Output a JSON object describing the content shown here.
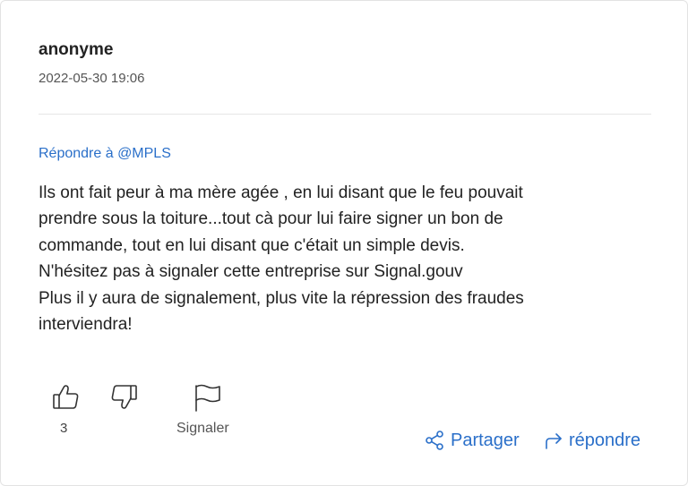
{
  "comment": {
    "author": "anonyme",
    "date": "2022-05-30 19:06",
    "reply_to": "Répondre à @MPLS",
    "body_lines": [
      "Ils ont fait peur à ma mère agée , en lui disant que le feu pouvait",
      "prendre sous la toiture...tout cà pour lui faire signer un bon de",
      "commande, tout en lui disant que c'était un simple devis.",
      "N'hésitez pas à signaler cette entreprise sur Signal.gouv",
      "Plus il y aura de signalement, plus vite la répression des fraudes",
      "interviendra!"
    ]
  },
  "actions": {
    "like_count": "3",
    "signaler_label": "Signaler",
    "share_label": "Partager",
    "reply_label": "répondre",
    "accent_color": "#2a6fc9",
    "icons": [
      "thumbs-up-icon",
      "thumbs-down-icon",
      "flag-icon",
      "share-icon",
      "reply-arrow-icon"
    ]
  }
}
